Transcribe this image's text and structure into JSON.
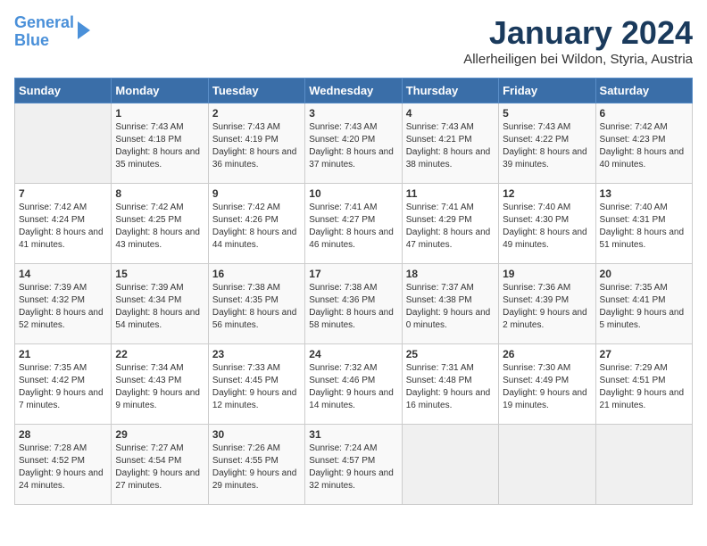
{
  "header": {
    "logo_line1": "General",
    "logo_line2": "Blue",
    "month": "January 2024",
    "location": "Allerheiligen bei Wildon, Styria, Austria"
  },
  "days_of_week": [
    "Sunday",
    "Monday",
    "Tuesday",
    "Wednesday",
    "Thursday",
    "Friday",
    "Saturday"
  ],
  "weeks": [
    [
      {
        "day": "",
        "sunrise": "",
        "sunset": "",
        "daylight": ""
      },
      {
        "day": "1",
        "sunrise": "Sunrise: 7:43 AM",
        "sunset": "Sunset: 4:18 PM",
        "daylight": "Daylight: 8 hours and 35 minutes."
      },
      {
        "day": "2",
        "sunrise": "Sunrise: 7:43 AM",
        "sunset": "Sunset: 4:19 PM",
        "daylight": "Daylight: 8 hours and 36 minutes."
      },
      {
        "day": "3",
        "sunrise": "Sunrise: 7:43 AM",
        "sunset": "Sunset: 4:20 PM",
        "daylight": "Daylight: 8 hours and 37 minutes."
      },
      {
        "day": "4",
        "sunrise": "Sunrise: 7:43 AM",
        "sunset": "Sunset: 4:21 PM",
        "daylight": "Daylight: 8 hours and 38 minutes."
      },
      {
        "day": "5",
        "sunrise": "Sunrise: 7:43 AM",
        "sunset": "Sunset: 4:22 PM",
        "daylight": "Daylight: 8 hours and 39 minutes."
      },
      {
        "day": "6",
        "sunrise": "Sunrise: 7:42 AM",
        "sunset": "Sunset: 4:23 PM",
        "daylight": "Daylight: 8 hours and 40 minutes."
      }
    ],
    [
      {
        "day": "7",
        "sunrise": "Sunrise: 7:42 AM",
        "sunset": "Sunset: 4:24 PM",
        "daylight": "Daylight: 8 hours and 41 minutes."
      },
      {
        "day": "8",
        "sunrise": "Sunrise: 7:42 AM",
        "sunset": "Sunset: 4:25 PM",
        "daylight": "Daylight: 8 hours and 43 minutes."
      },
      {
        "day": "9",
        "sunrise": "Sunrise: 7:42 AM",
        "sunset": "Sunset: 4:26 PM",
        "daylight": "Daylight: 8 hours and 44 minutes."
      },
      {
        "day": "10",
        "sunrise": "Sunrise: 7:41 AM",
        "sunset": "Sunset: 4:27 PM",
        "daylight": "Daylight: 8 hours and 46 minutes."
      },
      {
        "day": "11",
        "sunrise": "Sunrise: 7:41 AM",
        "sunset": "Sunset: 4:29 PM",
        "daylight": "Daylight: 8 hours and 47 minutes."
      },
      {
        "day": "12",
        "sunrise": "Sunrise: 7:40 AM",
        "sunset": "Sunset: 4:30 PM",
        "daylight": "Daylight: 8 hours and 49 minutes."
      },
      {
        "day": "13",
        "sunrise": "Sunrise: 7:40 AM",
        "sunset": "Sunset: 4:31 PM",
        "daylight": "Daylight: 8 hours and 51 minutes."
      }
    ],
    [
      {
        "day": "14",
        "sunrise": "Sunrise: 7:39 AM",
        "sunset": "Sunset: 4:32 PM",
        "daylight": "Daylight: 8 hours and 52 minutes."
      },
      {
        "day": "15",
        "sunrise": "Sunrise: 7:39 AM",
        "sunset": "Sunset: 4:34 PM",
        "daylight": "Daylight: 8 hours and 54 minutes."
      },
      {
        "day": "16",
        "sunrise": "Sunrise: 7:38 AM",
        "sunset": "Sunset: 4:35 PM",
        "daylight": "Daylight: 8 hours and 56 minutes."
      },
      {
        "day": "17",
        "sunrise": "Sunrise: 7:38 AM",
        "sunset": "Sunset: 4:36 PM",
        "daylight": "Daylight: 8 hours and 58 minutes."
      },
      {
        "day": "18",
        "sunrise": "Sunrise: 7:37 AM",
        "sunset": "Sunset: 4:38 PM",
        "daylight": "Daylight: 9 hours and 0 minutes."
      },
      {
        "day": "19",
        "sunrise": "Sunrise: 7:36 AM",
        "sunset": "Sunset: 4:39 PM",
        "daylight": "Daylight: 9 hours and 2 minutes."
      },
      {
        "day": "20",
        "sunrise": "Sunrise: 7:35 AM",
        "sunset": "Sunset: 4:41 PM",
        "daylight": "Daylight: 9 hours and 5 minutes."
      }
    ],
    [
      {
        "day": "21",
        "sunrise": "Sunrise: 7:35 AM",
        "sunset": "Sunset: 4:42 PM",
        "daylight": "Daylight: 9 hours and 7 minutes."
      },
      {
        "day": "22",
        "sunrise": "Sunrise: 7:34 AM",
        "sunset": "Sunset: 4:43 PM",
        "daylight": "Daylight: 9 hours and 9 minutes."
      },
      {
        "day": "23",
        "sunrise": "Sunrise: 7:33 AM",
        "sunset": "Sunset: 4:45 PM",
        "daylight": "Daylight: 9 hours and 12 minutes."
      },
      {
        "day": "24",
        "sunrise": "Sunrise: 7:32 AM",
        "sunset": "Sunset: 4:46 PM",
        "daylight": "Daylight: 9 hours and 14 minutes."
      },
      {
        "day": "25",
        "sunrise": "Sunrise: 7:31 AM",
        "sunset": "Sunset: 4:48 PM",
        "daylight": "Daylight: 9 hours and 16 minutes."
      },
      {
        "day": "26",
        "sunrise": "Sunrise: 7:30 AM",
        "sunset": "Sunset: 4:49 PM",
        "daylight": "Daylight: 9 hours and 19 minutes."
      },
      {
        "day": "27",
        "sunrise": "Sunrise: 7:29 AM",
        "sunset": "Sunset: 4:51 PM",
        "daylight": "Daylight: 9 hours and 21 minutes."
      }
    ],
    [
      {
        "day": "28",
        "sunrise": "Sunrise: 7:28 AM",
        "sunset": "Sunset: 4:52 PM",
        "daylight": "Daylight: 9 hours and 24 minutes."
      },
      {
        "day": "29",
        "sunrise": "Sunrise: 7:27 AM",
        "sunset": "Sunset: 4:54 PM",
        "daylight": "Daylight: 9 hours and 27 minutes."
      },
      {
        "day": "30",
        "sunrise": "Sunrise: 7:26 AM",
        "sunset": "Sunset: 4:55 PM",
        "daylight": "Daylight: 9 hours and 29 minutes."
      },
      {
        "day": "31",
        "sunrise": "Sunrise: 7:24 AM",
        "sunset": "Sunset: 4:57 PM",
        "daylight": "Daylight: 9 hours and 32 minutes."
      },
      {
        "day": "",
        "sunrise": "",
        "sunset": "",
        "daylight": ""
      },
      {
        "day": "",
        "sunrise": "",
        "sunset": "",
        "daylight": ""
      },
      {
        "day": "",
        "sunrise": "",
        "sunset": "",
        "daylight": ""
      }
    ]
  ]
}
